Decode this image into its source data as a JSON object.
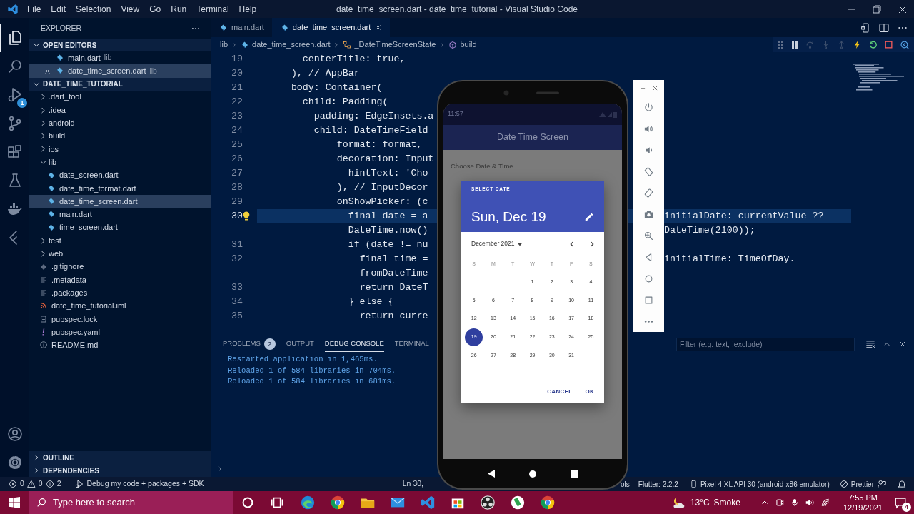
{
  "title_bar": {
    "menu": [
      "File",
      "Edit",
      "Selection",
      "View",
      "Go",
      "Run",
      "Terminal",
      "Help"
    ],
    "title": "date_time_screen.dart - date_time_tutorial - Visual Studio Code"
  },
  "activity_bar": {
    "items": [
      {
        "kind": "files",
        "selected": true
      },
      {
        "kind": "search",
        "selected": false
      },
      {
        "kind": "debug",
        "selected": false,
        "badge": "1"
      },
      {
        "kind": "git",
        "selected": false
      },
      {
        "kind": "extensions",
        "selected": false
      },
      {
        "kind": "testing",
        "selected": false
      },
      {
        "kind": "docker",
        "selected": false
      },
      {
        "kind": "flutter",
        "selected": false
      }
    ],
    "bottom": [
      {
        "kind": "account"
      },
      {
        "kind": "gear"
      }
    ]
  },
  "sidebar": {
    "title": "EXPLORER",
    "open_editors": {
      "label": "OPEN EDITORS",
      "expanded": true,
      "items": [
        {
          "name": "main.dart",
          "path": "lib",
          "selected": false
        },
        {
          "name": "date_time_screen.dart",
          "path": "lib",
          "selected": true
        }
      ]
    },
    "project": {
      "label": "DATE_TIME_TUTORIAL",
      "expanded": true,
      "tree": [
        {
          "name": ".dart_tool",
          "kind": "folder",
          "expanded": false,
          "selected": false
        },
        {
          "name": ".idea",
          "kind": "folder",
          "expanded": false,
          "selected": false
        },
        {
          "name": "android",
          "kind": "folder",
          "expanded": false,
          "selected": false
        },
        {
          "name": "build",
          "kind": "folder",
          "expanded": false,
          "selected": false
        },
        {
          "name": "ios",
          "kind": "folder",
          "expanded": false,
          "selected": false
        },
        {
          "name": "lib",
          "kind": "folder",
          "expanded": true,
          "selected": false,
          "children": [
            {
              "name": "date_screen.dart",
              "kind": "dart",
              "selected": false
            },
            {
              "name": "date_time_format.dart",
              "kind": "dart",
              "selected": false
            },
            {
              "name": "date_time_screen.dart",
              "kind": "dart",
              "selected": true
            },
            {
              "name": "main.dart",
              "kind": "dart",
              "selected": false
            },
            {
              "name": "time_screen.dart",
              "kind": "dart",
              "selected": false
            }
          ]
        },
        {
          "name": "test",
          "kind": "folder",
          "expanded": false,
          "selected": false
        },
        {
          "name": "web",
          "kind": "folder",
          "expanded": false,
          "selected": false
        },
        {
          "name": ".gitignore",
          "kind": "git",
          "selected": false
        },
        {
          "name": ".metadata",
          "kind": "text",
          "selected": false
        },
        {
          "name": ".packages",
          "kind": "text",
          "selected": false
        },
        {
          "name": "date_time_tutorial.iml",
          "kind": "rss",
          "selected": false
        },
        {
          "name": "pubspec.lock",
          "kind": "lock",
          "selected": false
        },
        {
          "name": "pubspec.yaml",
          "kind": "yaml",
          "selected": false
        },
        {
          "name": "README.md",
          "kind": "info",
          "selected": false
        }
      ]
    },
    "sections": [
      {
        "label": "OUTLINE",
        "expanded": false
      },
      {
        "label": "DEPENDENCIES",
        "expanded": false
      }
    ]
  },
  "editor": {
    "tabs": [
      {
        "label": "main.dart",
        "selected": false
      },
      {
        "label": "date_time_screen.dart",
        "selected": true
      }
    ],
    "breadcrumbs": [
      {
        "label": "lib",
        "kind": "folder"
      },
      {
        "label": "date_time_screen.dart",
        "kind": "dart"
      },
      {
        "label": "_DateTimeScreenState",
        "kind": "class"
      },
      {
        "label": "build",
        "kind": "method"
      }
    ],
    "lines": [
      {
        "number": "19",
        "text": "        centerTitle: true,"
      },
      {
        "number": "20",
        "text": "      ), // AppBar"
      },
      {
        "number": "21",
        "text": "      body: Container("
      },
      {
        "number": "22",
        "text": "        child: Padding("
      },
      {
        "number": "23",
        "text": "          padding: EdgeInsets.a"
      },
      {
        "number": "24",
        "text": "          child: DateTimeField"
      },
      {
        "number": "25",
        "text": "              format: format,"
      },
      {
        "number": "26",
        "text": "              decoration: Input"
      },
      {
        "number": "27",
        "text": "                hintText: 'Cho"
      },
      {
        "number": "28",
        "text": "              ), // InputDecor"
      },
      {
        "number": "29",
        "text": "              onShowPicker: (c"
      },
      {
        "number": "30",
        "text": "                final date = a",
        "current": true,
        "lightbulb": true,
        "overflow": "initialDate: currentValue ??"
      },
      {
        "text": "                DateTime.now()",
        "overflow": "DateTime(2100));"
      },
      {
        "number": "31",
        "text": "                if (date != nu"
      },
      {
        "number": "32",
        "text": "                  final time =",
        "overflow": "initialTime: TimeOfDay."
      },
      {
        "text": "                  fromDateTime"
      },
      {
        "number": "33",
        "text": "                  return DateT"
      },
      {
        "number": "34",
        "text": "                } else {"
      },
      {
        "number": "35",
        "text": "                  return curre"
      }
    ]
  },
  "phone": {
    "status_time": "11:57",
    "app_bar_title": "Date Time Screen",
    "field_hint": "Choose Date & Time",
    "dialog": {
      "header_label": "SELECT DATE",
      "selected_date": "Sun, Dec 19",
      "month": "December 2021",
      "weekdays": [
        "S",
        "M",
        "T",
        "W",
        "T",
        "F",
        "S"
      ],
      "weeks": [
        {
          "days": [
            {
              "kind": "blank"
            },
            {
              "kind": "blank"
            },
            {
              "kind": "blank"
            },
            {
              "day": "1",
              "selected": false
            },
            {
              "day": "2",
              "selected": false
            },
            {
              "day": "3",
              "selected": false
            },
            {
              "day": "4",
              "selected": false
            }
          ]
        },
        {
          "days": [
            {
              "day": "5",
              "selected": false
            },
            {
              "day": "6",
              "selected": false
            },
            {
              "day": "7",
              "selected": false
            },
            {
              "day": "8",
              "selected": false
            },
            {
              "day": "9",
              "selected": false
            },
            {
              "day": "10",
              "selected": false
            },
            {
              "day": "11",
              "selected": false
            }
          ]
        },
        {
          "days": [
            {
              "day": "12",
              "selected": false
            },
            {
              "day": "13",
              "selected": false
            },
            {
              "day": "14",
              "selected": false
            },
            {
              "day": "15",
              "selected": false
            },
            {
              "day": "16",
              "selected": false
            },
            {
              "day": "17",
              "selected": false
            },
            {
              "day": "18",
              "selected": false
            }
          ]
        },
        {
          "days": [
            {
              "day": "19",
              "selected": true
            },
            {
              "day": "20",
              "selected": false
            },
            {
              "day": "21",
              "selected": false
            },
            {
              "day": "22",
              "selected": false
            },
            {
              "day": "23",
              "selected": false
            },
            {
              "day": "24",
              "selected": false
            },
            {
              "day": "25",
              "selected": false
            }
          ]
        },
        {
          "days": [
            {
              "day": "26",
              "selected": false
            },
            {
              "day": "27",
              "selected": false
            },
            {
              "day": "28",
              "selected": false
            },
            {
              "day": "29",
              "selected": false
            },
            {
              "day": "30",
              "selected": false
            },
            {
              "day": "31",
              "selected": false
            }
          ]
        }
      ],
      "buttons": [
        "CANCEL",
        "OK"
      ]
    }
  },
  "panel": {
    "tabs": [
      {
        "label": "PROBLEMS",
        "badge": "2",
        "selected": false
      },
      {
        "label": "OUTPUT",
        "selected": false
      },
      {
        "label": "DEBUG CONSOLE",
        "selected": true
      },
      {
        "label": "TERMINAL",
        "selected": false
      }
    ],
    "filter_placeholder": "Filter (e.g. text, !exclude)",
    "console": [
      "Restarted application in 1,465ms.",
      "Reloaded 1 of 584 libraries in 704ms.",
      "Reloaded 1 of 584 libraries in 681ms."
    ]
  },
  "status_bar": {
    "errors": "0",
    "warnings": "0",
    "infos": "2",
    "debug_config": "Debug my code + packages + SDK",
    "position": "Ln 30,",
    "devtools": "ols",
    "flutter": "Flutter: 2.2.2",
    "device": "Pixel 4 XL API 30 (android-x86 emulator)",
    "formatter": "Prettier"
  },
  "taskbar": {
    "search_placeholder": "Type here to search",
    "apps": [
      {
        "kind": "cortana"
      },
      {
        "kind": "taskview"
      },
      {
        "kind": "edge"
      },
      {
        "kind": "chrome"
      },
      {
        "kind": "folder"
      },
      {
        "kind": "mail"
      },
      {
        "kind": "vscode"
      },
      {
        "kind": "store"
      },
      {
        "kind": "obs"
      },
      {
        "kind": "phone-app"
      },
      {
        "kind": "chrome"
      }
    ],
    "temperature": "13°C",
    "weather": "Smoke",
    "time": "7:55 PM",
    "date": "12/19/2021",
    "notifications": "4"
  }
}
